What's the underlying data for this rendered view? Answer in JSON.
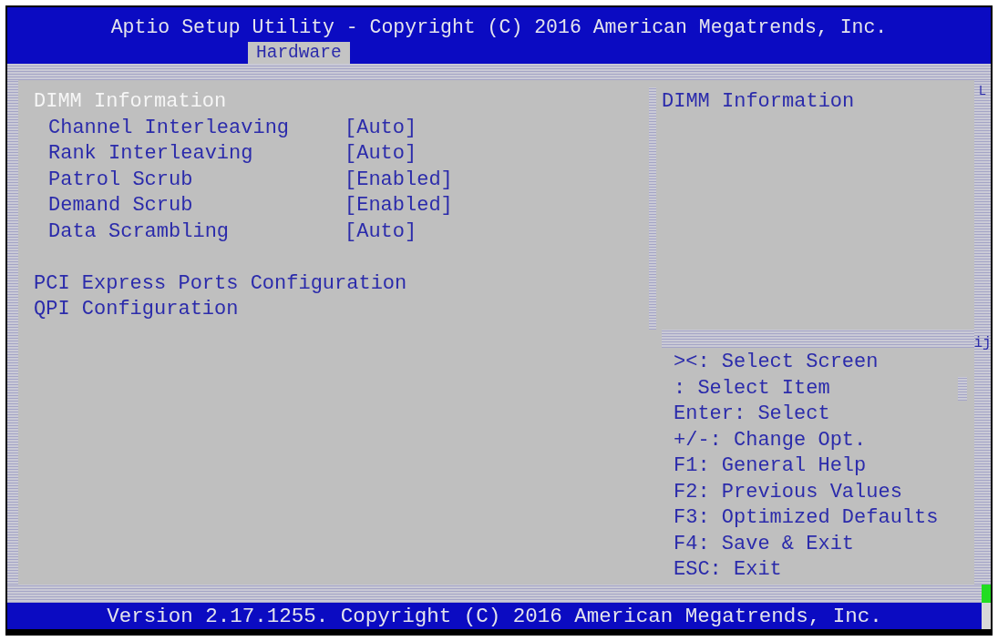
{
  "header": {
    "title": "Aptio Setup Utility - Copyright (C) 2016 American Megatrends, Inc.",
    "tabs": [
      {
        "label": "Hardware",
        "selected": true
      }
    ]
  },
  "menu": {
    "items": [
      {
        "kind": "submenu",
        "label": "DIMM Information",
        "selected": true,
        "children": [
          {
            "kind": "setting",
            "label": "Channel Interleaving",
            "value": "[Auto]",
            "selected": false
          },
          {
            "kind": "setting",
            "label": "Rank Interleaving",
            "value": "[Auto]",
            "selected": false
          },
          {
            "kind": "setting",
            "label": "Patrol Scrub",
            "value": "[Enabled]",
            "selected": false
          },
          {
            "kind": "setting",
            "label": "Demand Scrub",
            "value": "[Enabled]",
            "selected": false
          },
          {
            "kind": "setting",
            "label": "Data Scrambling",
            "value": "[Auto]",
            "selected": false
          }
        ]
      },
      {
        "kind": "submenu",
        "label": "PCI Express Ports Configuration",
        "selected": false
      },
      {
        "kind": "submenu",
        "label": "QPI Configuration",
        "selected": false
      }
    ]
  },
  "help_panel": {
    "title": "DIMM Information",
    "keys": [
      "><: Select Screen",
      ": Select Item",
      "Enter: Select",
      "+/-: Change Opt.",
      "F1: General Help",
      "F2: Previous Values",
      "F3: Optimized Defaults",
      "F4: Save & Exit",
      "ESC: Exit"
    ]
  },
  "frame_glyphs": {
    "top": "L",
    "divider": "ij"
  },
  "footer": {
    "text": "Version 2.17.1255. Copyright (C) 2016 American Megatrends, Inc."
  }
}
